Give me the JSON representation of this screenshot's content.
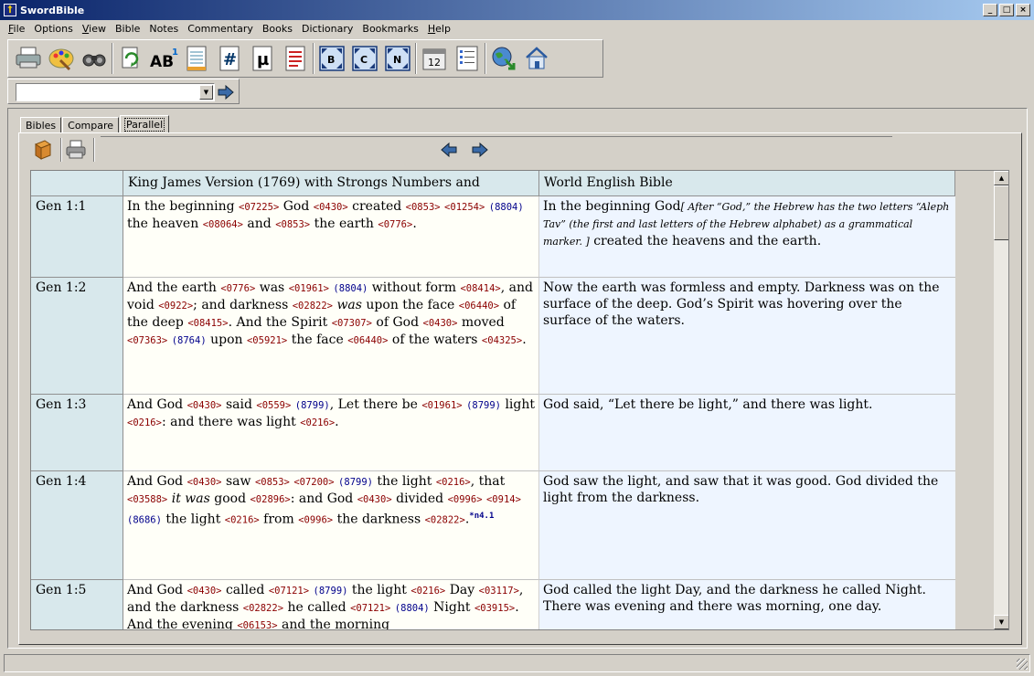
{
  "window": {
    "title": "SwordBible"
  },
  "menu": [
    {
      "pre": "",
      "ul": "F",
      "post": "ile"
    },
    {
      "pre": "",
      "ul": "",
      "post": "Options"
    },
    {
      "pre": "",
      "ul": "V",
      "post": "iew"
    },
    {
      "pre": "",
      "ul": "",
      "post": "Bible"
    },
    {
      "pre": "",
      "ul": "",
      "post": "Notes"
    },
    {
      "pre": "",
      "ul": "",
      "post": "Commentary"
    },
    {
      "pre": "",
      "ul": "",
      "post": "Books"
    },
    {
      "pre": "",
      "ul": "",
      "post": "Dictionary"
    },
    {
      "pre": "",
      "ul": "",
      "post": "Bookmarks"
    },
    {
      "pre": "",
      "ul": "H",
      "post": "elp"
    }
  ],
  "toolbar": {
    "icons": [
      "printer-icon",
      "palette-icon",
      "binoculars-icon",
      "sync-icon",
      "font-size-icon",
      "document-icon",
      "strongs-icon",
      "morphology-icon",
      "notes-icon",
      "bible-window-icon",
      "commentary-window-icon",
      "notes-window-icon",
      "calendar-icon",
      "list-icon",
      "globe-download-icon",
      "home-icon"
    ],
    "labels": {
      "font": "AB",
      "font_sup": "1",
      "strongs": "#",
      "morph": "µ",
      "b": "B",
      "c": "C",
      "n": "N",
      "cal": "12"
    }
  },
  "address": {
    "value": ""
  },
  "tabs": [
    "Bibles",
    "Compare",
    "Parallel"
  ],
  "active_tab": "Parallel",
  "grid": {
    "headers": [
      "King James Version (1769) with Strongs Numbers and",
      "World English Bible"
    ],
    "rows": [
      {
        "ref": "Gen 1:1"
      },
      {
        "ref": "Gen 1:2"
      },
      {
        "ref": "Gen 1:3"
      },
      {
        "ref": "Gen 1:4"
      },
      {
        "ref": "Gen 1:5"
      }
    ],
    "kjv": {
      "v1": [
        "In the beginning ",
        "<07225>",
        " God ",
        "<0430>",
        " created ",
        "<0853>",
        " ",
        "<01254>",
        " ",
        "(8804)",
        " the heaven ",
        "<08064>",
        " and ",
        "<0853>",
        " the earth ",
        "<0776>",
        "."
      ],
      "v2": [
        "And the earth ",
        "<0776>",
        " was ",
        "<01961>",
        " ",
        "(8804)",
        " without form ",
        "<08414>",
        ", and void ",
        "<0922>",
        "; and darkness ",
        "<02822>",
        " ",
        "was",
        " upon the face ",
        "<06440>",
        " of the deep ",
        "<08415>",
        ". And the Spirit ",
        "<07307>",
        " of God ",
        "<0430>",
        " moved ",
        "<07363>",
        " ",
        "(8764)",
        " upon ",
        "<05921>",
        " the face ",
        "<06440>",
        " of the waters ",
        "<04325>",
        "."
      ],
      "v3": [
        "And God ",
        "<0430>",
        " said ",
        "<0559>",
        " ",
        "(8799)",
        ", Let there be ",
        "<01961>",
        " ",
        "(8799)",
        " light ",
        "<0216>",
        ": and there was light ",
        "<0216>",
        "."
      ],
      "v4": [
        "And God ",
        "<0430>",
        " saw ",
        "<0853>",
        " ",
        "<07200>",
        " ",
        "(8799)",
        " the light ",
        "<0216>",
        ", that ",
        "<03588>",
        " ",
        "it was",
        " good ",
        "<02896>",
        ": and God ",
        "<0430>",
        " divided ",
        "<0996>",
        " ",
        "<0914>",
        " ",
        "(8686)",
        " the light ",
        "<0216>",
        " from ",
        "<0996>",
        " the darkness ",
        "<02822>",
        ".",
        "*n4.1"
      ],
      "v5": [
        "And God ",
        "<0430>",
        " called ",
        "<07121>",
        " ",
        "(8799)",
        " the light ",
        "<0216>",
        " Day ",
        "<03117>",
        ", and the darkness ",
        "<02822>",
        " he called ",
        "<07121>",
        " ",
        "(8804)",
        " Night ",
        "<03915>",
        ". And the evening ",
        "<06153>",
        " and the morning"
      ]
    },
    "web": {
      "v1_a": "In the beginning God",
      "v1_fn": "[ After “God,” the Hebrew has the two letters “Aleph Tav” (the first and last letters of the Hebrew alphabet) as a grammatical marker. ]",
      "v1_b": " created the heavens and the earth.",
      "v2": "Now the earth was formless and empty. Darkness was on the surface of the deep. God’s Spirit was hovering over the surface of the waters.",
      "v3": "God said, “Let there be light,” and there was light.",
      "v4": "God saw the light, and saw that it was good. God divided the light from the darkness.",
      "v5": "God called the light Day, and the darkness he called Night. There was evening and there was morning, one day."
    }
  }
}
